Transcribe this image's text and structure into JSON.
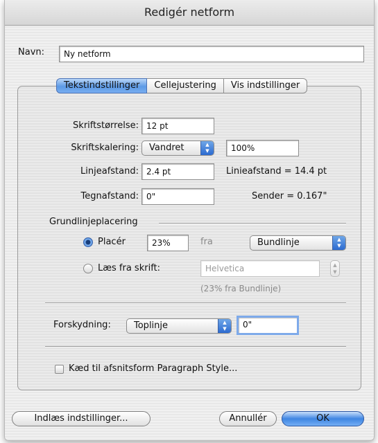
{
  "dialog": {
    "title": "Redigér netform",
    "name_label": "Navn:",
    "name_value": "Ny netform"
  },
  "tabs": [
    {
      "label": "Tekstindstillinger",
      "selected": true
    },
    {
      "label": "Cellejustering",
      "selected": false
    },
    {
      "label": "Vis indstillinger",
      "selected": false
    }
  ],
  "text_settings": {
    "font_size_label": "Skriftstørrelse:",
    "font_size_value": "12 pt",
    "scaling_label": "Skriftskalering:",
    "scaling_direction": "Vandret",
    "scaling_value": "100%",
    "leading_label": "Linjeafstand:",
    "leading_value": "2.4 pt",
    "leading_result": "Linieafstand = 14.4 pt",
    "tracking_label": "Tegnafstand:",
    "tracking_value": "0\"",
    "tracking_result": "Sender = 0.167\""
  },
  "baseline": {
    "section_label": "Grundlinjeplacering",
    "place_label": "Placér",
    "place_value": "23%",
    "from_label": "fra",
    "from_option": "Bundlinje",
    "read_label": "Læs fra skrift:",
    "font_value": "Helvetica",
    "read_hint": "(23% fra Bundlinje)",
    "selected_option": "place"
  },
  "offset": {
    "label": "Forskydning:",
    "option": "Toplinje",
    "value": "0\""
  },
  "link": {
    "label": "Kæd til afsnitsform Paragraph Style...",
    "checked": false
  },
  "buttons": {
    "load": "Indlæs indstillinger...",
    "cancel": "Annullér",
    "ok": "OK"
  },
  "colors": {
    "accent": "#4b8ee6"
  }
}
